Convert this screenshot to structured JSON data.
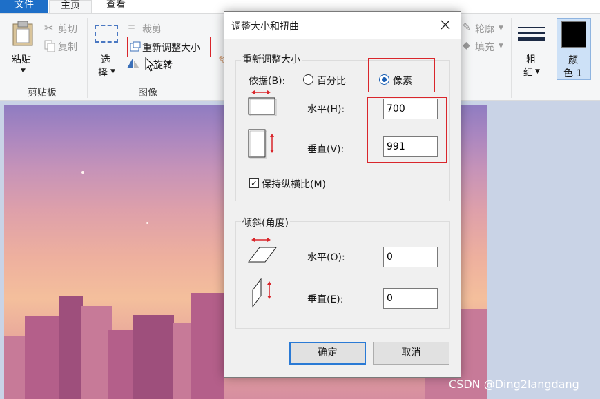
{
  "ribbon": {
    "tabs": [
      "文件",
      "主页",
      "查看"
    ],
    "clipboard": {
      "paste": "粘贴",
      "cut": "剪切",
      "copy": "复制",
      "group_label": "剪贴板"
    },
    "image": {
      "select_line1": "选",
      "select_line2": "择",
      "crop": "裁剪",
      "resize": "重新调整大小",
      "rotate": "旋转",
      "group_label": "图像"
    },
    "shapes": {
      "outline": "轮廓",
      "fill": "填充"
    },
    "size": {
      "line1": "粗",
      "line2": "细"
    },
    "color1": {
      "line1": "颜",
      "line2": "色 1",
      "value": "#000000"
    }
  },
  "dialog": {
    "title": "调整大小和扭曲",
    "resize_group": "重新调整大小",
    "by_label": "依据(B):",
    "percent_option": "百分比",
    "pixels_option": "像素",
    "horizontal_label": "水平(H):",
    "horizontal_value": "700",
    "vertical_label": "垂直(V):",
    "vertical_value": "991",
    "keep_ratio_label": "保持纵横比(M)",
    "keep_ratio_checked": true,
    "skew_group": "倾斜(角度)",
    "skew_h_label": "水平(O):",
    "skew_h_value": "0",
    "skew_v_label": "垂直(E):",
    "skew_v_value": "0",
    "ok_label": "确定",
    "cancel_label": "取消"
  },
  "watermark": "CSDN @Ding2langdang",
  "colors": {
    "accent": "#1e6fc8",
    "highlight": "#d9262b"
  }
}
